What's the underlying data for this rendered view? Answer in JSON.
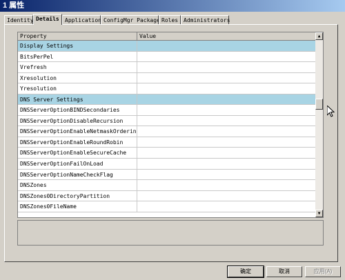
{
  "window": {
    "title": "1 属性"
  },
  "tabs": [
    "Identity",
    "Details",
    "Applications",
    "ConfigMgr Packages",
    "Roles",
    "Administrators"
  ],
  "grid": {
    "headers": {
      "property": "Property",
      "value": "Value"
    },
    "rows": [
      {
        "property": "Display Settings",
        "value": "",
        "section": true
      },
      {
        "property": "BitsPerPel",
        "value": ""
      },
      {
        "property": "Vrefresh",
        "value": ""
      },
      {
        "property": "Xresolution",
        "value": ""
      },
      {
        "property": "Yresolution",
        "value": ""
      },
      {
        "property": "DNS Server Settings",
        "value": "",
        "section": true
      },
      {
        "property": "DNSServerOptionBINDSecondaries",
        "value": ""
      },
      {
        "property": "DNSServerOptionDisableRecursion",
        "value": ""
      },
      {
        "property": "DNSServerOptionEnableNetmaskOrdering",
        "value": ""
      },
      {
        "property": "DNSServerOptionEnableRoundRobin",
        "value": ""
      },
      {
        "property": "DNSServerOptionEnableSecureCache",
        "value": ""
      },
      {
        "property": "DNSServerOptionFailOnLoad",
        "value": ""
      },
      {
        "property": "DNSServerOptionNameCheckFlag",
        "value": ""
      },
      {
        "property": "DNSZones",
        "value": ""
      },
      {
        "property": "DNSZones0DirectoryPartition",
        "value": ""
      },
      {
        "property": "DNSZones0FileName",
        "value": ""
      }
    ]
  },
  "buttons": {
    "ok": "确定",
    "cancel": "取消",
    "apply": "应用(A)"
  },
  "colors": {
    "section_row": "#a8d4e4",
    "title_start": "#0a246a",
    "title_end": "#a6caf0"
  }
}
